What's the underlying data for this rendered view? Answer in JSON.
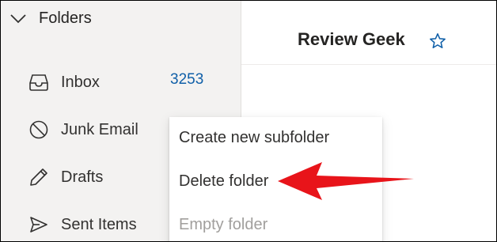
{
  "sidebar": {
    "header_label": "Folders",
    "items": [
      {
        "label": "Inbox",
        "icon": "inbox-icon",
        "count": "3253"
      },
      {
        "label": "Junk Email",
        "icon": "junk-icon"
      },
      {
        "label": "Drafts",
        "icon": "pencil-icon"
      },
      {
        "label": "Sent Items",
        "icon": "send-icon"
      }
    ]
  },
  "main": {
    "title": "Review Geek",
    "favorite_icon": "star-icon"
  },
  "context_menu": {
    "items": [
      {
        "label": "Create new subfolder",
        "enabled": true
      },
      {
        "label": "Delete folder",
        "enabled": true
      },
      {
        "label": "Empty folder",
        "enabled": false
      }
    ]
  },
  "colors": {
    "accent": "#0f5fa8",
    "sidebar_bg": "#f3f2f1",
    "annotation_arrow": "#e8141a"
  }
}
